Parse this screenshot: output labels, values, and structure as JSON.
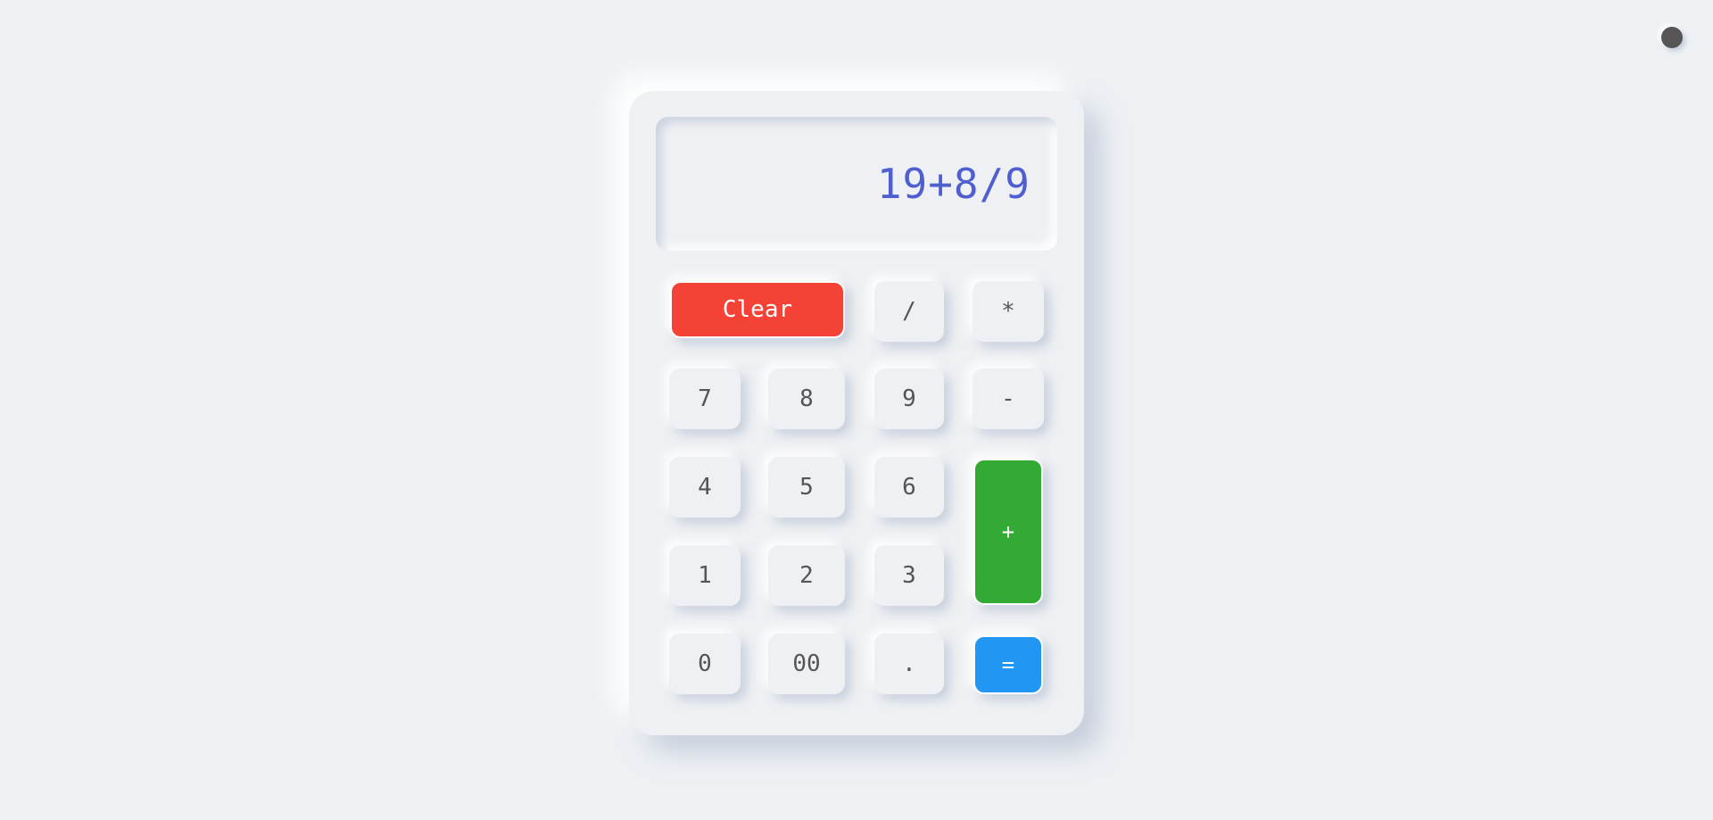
{
  "display": {
    "expression": "19+8/9"
  },
  "keys": {
    "clear": "Clear",
    "divide": "/",
    "multiply": "*",
    "seven": "7",
    "eight": "8",
    "nine": "9",
    "minus": "-",
    "four": "4",
    "five": "5",
    "six": "6",
    "plus": "+",
    "one": "1",
    "two": "2",
    "three": "3",
    "zero": "0",
    "double_zero": "00",
    "decimal": ".",
    "equals": "="
  },
  "colors": {
    "background": "#eef1f4",
    "display_text": "#4f5fcf",
    "clear": "#f44336",
    "plus": "#33aa33",
    "equals": "#2196f3",
    "key_text": "#555555"
  },
  "icons": {
    "theme_toggle": "circle-toggle-icon"
  }
}
